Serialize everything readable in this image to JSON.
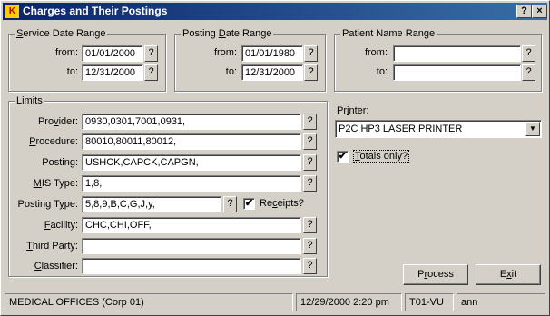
{
  "window": {
    "title": "Charges and Their Postings",
    "app_icon": "app-icon",
    "help_label": "?",
    "close_label": "×"
  },
  "service_date": {
    "title_pre": "",
    "title_acc": "S",
    "title_post": "ervice Date Range",
    "from_label": "from:",
    "from_value": "01/01/2000",
    "to_label": "to:",
    "to_value": "12/31/2000"
  },
  "posting_date": {
    "title_pre": "Posting ",
    "title_acc": "D",
    "title_post": "ate Range",
    "from_label": "from:",
    "from_value": "01/01/1980",
    "to_label": "to:",
    "to_value": "12/31/2000"
  },
  "patient_name": {
    "title": "Patient Name Range",
    "from_label": "from:",
    "from_value": "",
    "to_label": "to:",
    "to_value": ""
  },
  "limits": {
    "title": "Limits",
    "provider": {
      "pre": "Pro",
      "acc": "v",
      "post": "ider:",
      "value": "0930,0301,7001,0931,"
    },
    "procedure": {
      "pre": "",
      "acc": "P",
      "post": "rocedure:",
      "value": "80010,80011,80012,"
    },
    "posting": {
      "pre": "Postin",
      "acc": "g",
      "post": ":",
      "value": "USHCK,CAPCK,CAPGN,"
    },
    "mis_type": {
      "pre": "",
      "acc": "M",
      "post": "IS Type:",
      "value": "1,8,"
    },
    "posting_type": {
      "pre": "Posting T",
      "acc": "y",
      "post": "pe:",
      "value": "5,8,9,B,C,G,J,y,"
    },
    "receipts": {
      "pre": "Re",
      "acc": "c",
      "post": "eipts?",
      "checked": true
    },
    "facility": {
      "pre": "",
      "acc": "F",
      "post": "acility:",
      "value": "CHC,CHI,OFF,"
    },
    "third_party": {
      "pre": "",
      "acc": "T",
      "post": "hird Party:",
      "value": ""
    },
    "classifier": {
      "pre": "",
      "acc": "C",
      "post": "lassifier:",
      "value": ""
    }
  },
  "lookup_label": "?",
  "check_mark": "✔",
  "printer": {
    "label_pre": "Pr",
    "label_acc": "i",
    "label_post": "nter:",
    "selected": "P2C  HP3 LASER PRINTER",
    "dropdown_arrow": "▼"
  },
  "totals_only": {
    "pre": "",
    "acc": "T",
    "post": "otals only?",
    "checked": true
  },
  "buttons": {
    "process_pre": "P",
    "process_acc": "r",
    "process_post": "ocess",
    "exit_pre": "E",
    "exit_acc": "x",
    "exit_post": "it"
  },
  "status": {
    "office": "MEDICAL OFFICES (Corp 01)",
    "datetime": "12/29/2000  2:20 pm",
    "terminal": "T01-VU",
    "user": "ann"
  }
}
